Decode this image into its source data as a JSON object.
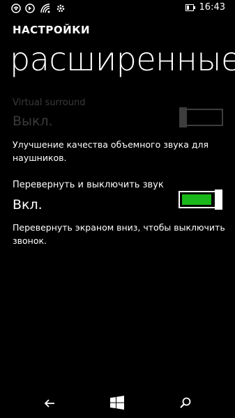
{
  "status": {
    "time": "16:43",
    "icons": [
      "nfc-icon",
      "location-icon",
      "wifi-icon",
      "settings-icon",
      "battery-icon"
    ]
  },
  "header": {
    "app_title": "НАСТРОЙКИ",
    "page_title": "расширенные"
  },
  "settings": [
    {
      "label": "Virtual surround",
      "value": "Выкл.",
      "enabled": false,
      "toggled": false,
      "description": "Улучшение качества объемного звука для наушников."
    },
    {
      "label": "Перевернуть и выключить звук",
      "value": "Вкл.",
      "enabled": true,
      "toggled": true,
      "description": "Перевернуть экраном вниз, чтобы выключить звонок."
    }
  ],
  "colors": {
    "accent": "#1ab71a",
    "background": "#000000",
    "disabled": "#3a3a3a"
  },
  "nav": {
    "buttons": [
      "back-icon",
      "windows-start-icon",
      "search-icon"
    ]
  }
}
